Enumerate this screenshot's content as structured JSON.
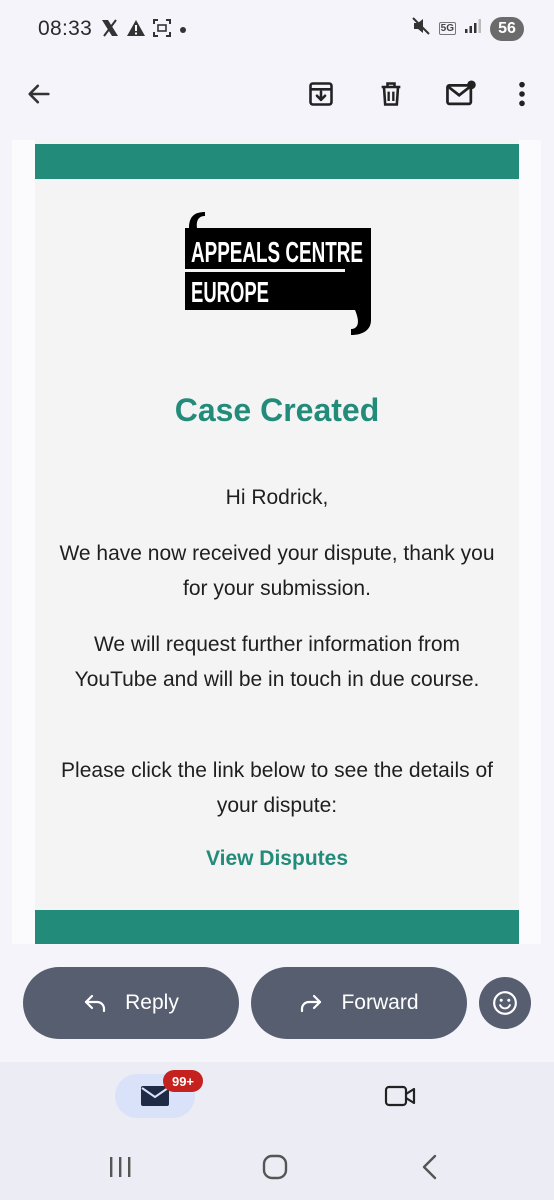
{
  "status_bar": {
    "time": "08:33",
    "network": "5G",
    "battery": "56"
  },
  "app_bar": {
    "back_icon": "arrow-left-icon",
    "actions": [
      "archive-icon",
      "trash-icon",
      "mark-unread-icon",
      "more-vert-icon"
    ]
  },
  "email": {
    "logo_text_line1": "APPEALS CENTRE",
    "logo_text_line2": "EUROPE",
    "title": "Case Created",
    "greeting": "Hi Rodrick,",
    "paragraph1": "We have now received your dispute, thank you for your submission.",
    "paragraph2": "We will request further information from YouTube and will be in touch in due course.",
    "paragraph3": "Please click the link below to see the details of your dispute:",
    "link": "View Disputes",
    "accent_color": "#238b7a"
  },
  "actions": {
    "reply_label": "Reply",
    "forward_label": "Forward"
  },
  "bottom_nav": {
    "mail_badge": "99+"
  }
}
